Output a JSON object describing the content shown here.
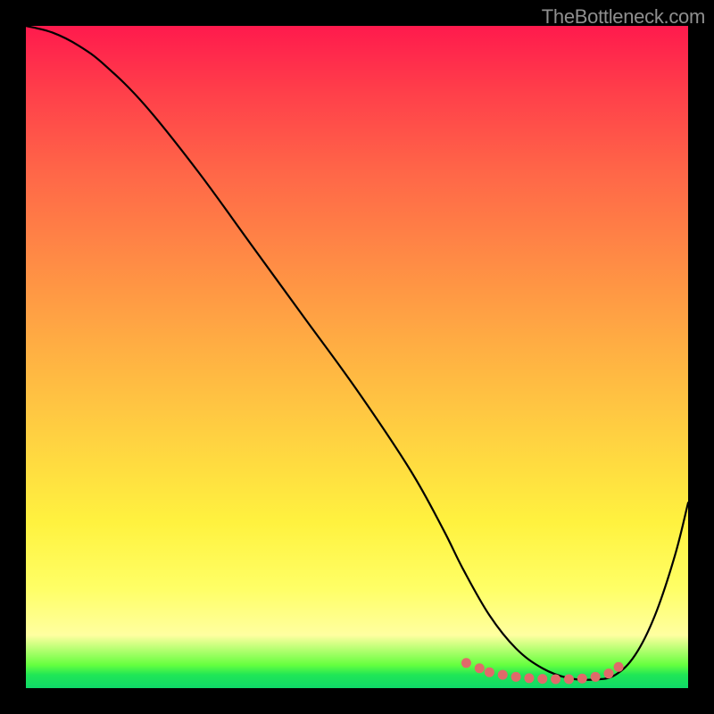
{
  "watermark": "TheBottleneck.com",
  "chart_data": {
    "type": "line",
    "title": "",
    "xlabel": "",
    "ylabel": "",
    "xlim": [
      0,
      100
    ],
    "ylim": [
      0,
      100
    ],
    "series": [
      {
        "name": "curve",
        "x": [
          0,
          4,
          8,
          12,
          18,
          26,
          34,
          42,
          50,
          58,
          63,
          66,
          70,
          74,
          78,
          82,
          86,
          89,
          92,
          95,
          98,
          100
        ],
        "y": [
          100,
          99,
          97,
          94,
          88,
          78,
          67,
          56,
          45,
          33,
          24,
          18,
          11,
          6,
          3,
          1.5,
          1.3,
          2,
          5,
          11,
          20,
          28
        ]
      }
    ],
    "markers": {
      "name": "highlight-dots",
      "x": [
        66.5,
        68.5,
        70,
        72,
        74,
        76,
        78,
        80,
        82,
        84,
        86,
        88,
        89.5
      ],
      "y": [
        3.8,
        3.0,
        2.4,
        2.0,
        1.7,
        1.5,
        1.4,
        1.35,
        1.35,
        1.45,
        1.7,
        2.2,
        3.2
      ]
    }
  }
}
